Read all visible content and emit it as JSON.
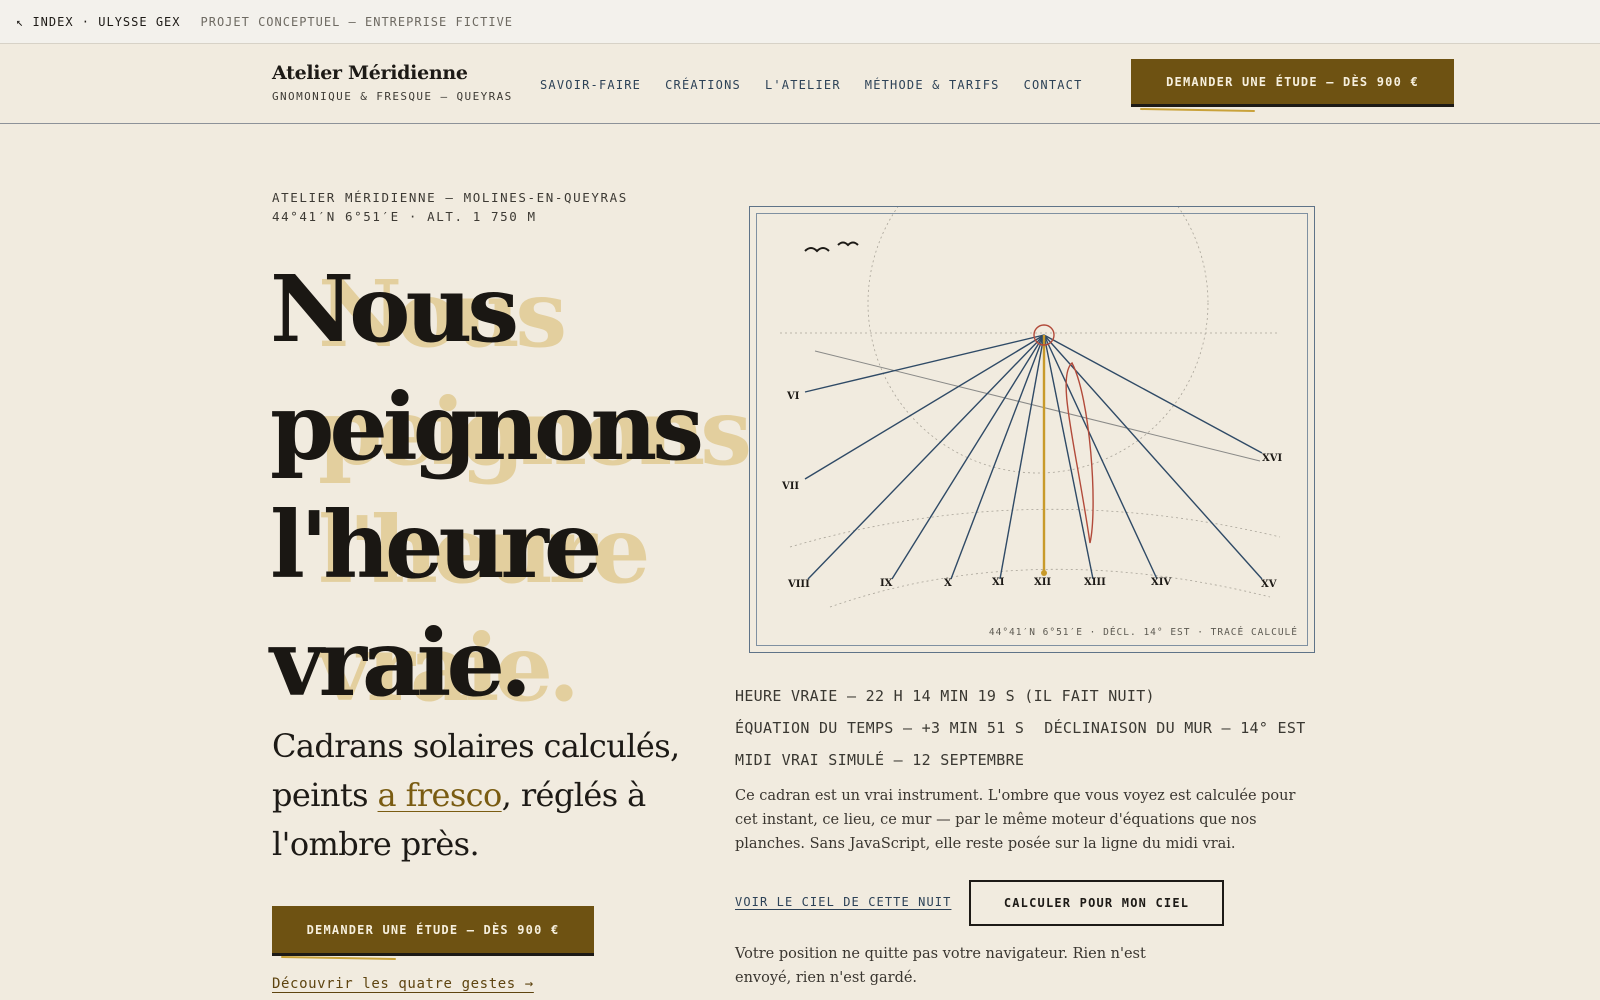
{
  "topbar": {
    "index_label": "↖ INDEX · ULYSSE GEX",
    "project_label": "PROJET CONCEPTUEL — ENTREPRISE FICTIVE"
  },
  "header": {
    "brand_name": "Atelier Méridienne",
    "brand_sub": "GNOMONIQUE & FRESQUE — QUEYRAS",
    "nav": [
      "SAVOIR-FAIRE",
      "CRÉATIONS",
      "L'ATELIER",
      "MÉTHODE & TARIFS",
      "CONTACT"
    ],
    "cta": "DEMANDER UNE ÉTUDE — DÈS 900 €"
  },
  "hero": {
    "location_line1": "ATELIER MÉRIDIENNE — MOLINES-EN-QUEYRAS",
    "location_line2": "44°41′N 6°51′E · ALT. 1 750 M",
    "headline": [
      "Nous",
      "peignons",
      "l'heure",
      "vraie."
    ],
    "tagline_before": "Cadrans solaires calculés, peints ",
    "tagline_accent": "a fresco",
    "tagline_after": ", réglés à l'ombre près.",
    "cta": "DEMANDER UNE ÉTUDE — DÈS 900 €",
    "discover_link": "Découvrir les quatre gestes →"
  },
  "dial": {
    "hour_labels": [
      "VI",
      "VII",
      "VIII",
      "IX",
      "X",
      "XI",
      "XII",
      "XIII",
      "XIV",
      "XV",
      "XVI"
    ],
    "caption": "44°41′N 6°51′E · DÉCL. 14° EST · TRACÉ CALCULÉ",
    "colors": {
      "line": "#2f4a66",
      "gnomon": "#c89a2a",
      "analemma": "#b24a3a"
    }
  },
  "readouts": {
    "true_time": "HEURE VRAIE — 22 H 14 MIN 19 S (IL FAIT NUIT)",
    "equation": "ÉQUATION DU TEMPS — +3 MIN 51 S",
    "declination": "DÉCLINAISON DU MUR — 14° EST",
    "simulated_noon": "MIDI VRAI SIMULÉ — 12 SEPTEMBRE"
  },
  "description": "Ce cadran est un vrai instrument. L'ombre que vous voyez est calculée pour cet instant, ce lieu, ce mur — par le même moteur d'équations que nos planches. Sans JavaScript, elle reste posée sur la ligne du midi vrai.",
  "actions": {
    "sky_link": "VOIR LE CIEL DE CETTE NUIT",
    "calc_button": "CALCULER POUR MON CIEL"
  },
  "privacy": "Votre position ne quitte pas votre navigateur. Rien n'est envoyé, rien n'est gardé."
}
